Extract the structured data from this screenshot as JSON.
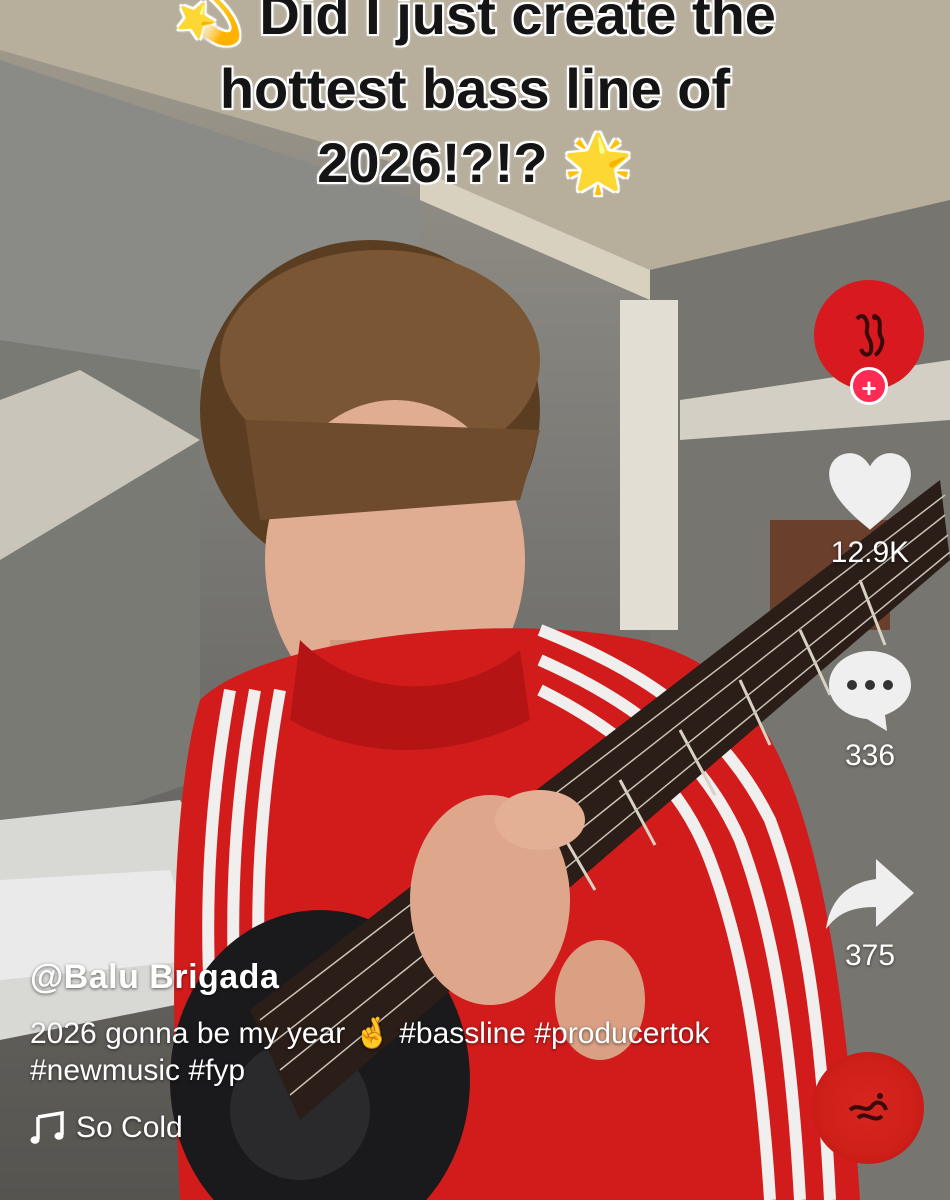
{
  "overlay": {
    "line1_prefix": "💫",
    "line1": "Did I just create the",
    "line2": "hottest bass line of",
    "line3": "2026!?!?",
    "line3_suffix": "🌟"
  },
  "creator": {
    "username": "@Balu Brigada",
    "avatar_color": "#d8191f",
    "follow_symbol": "+"
  },
  "description": "2026 gonna be my year 🤞 #bassline #producertok #newmusic #fyp",
  "sound": {
    "icon": "music-note-icon",
    "title": "So Cold"
  },
  "actions": {
    "likes": "12.9K",
    "comments": "336",
    "shares": "375"
  },
  "colors": {
    "follow_badge": "#fe2c55",
    "jacket_red": "#d21c1c"
  }
}
